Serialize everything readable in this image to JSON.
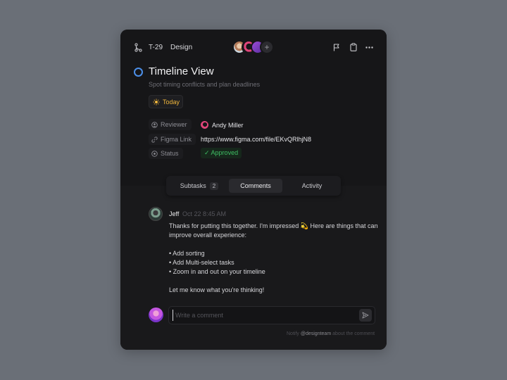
{
  "header": {
    "task_id": "T-29",
    "project": "Design",
    "avatar_more": "+",
    "icons": [
      "branch-icon",
      "flag-icon",
      "clipboard-icon",
      "more-icon"
    ]
  },
  "task": {
    "title": "Timeline View",
    "subtitle": "Spot timing conflicts and plan deadlines",
    "due_chip": "Today"
  },
  "properties": [
    {
      "label": "Reviewer",
      "icon": "user-circle-icon",
      "value": "Andy Miller"
    },
    {
      "label": "Figma Link",
      "icon": "link-icon",
      "value": "https://www.figma.com/file/EKvQRlhjN8"
    },
    {
      "label": "Status",
      "icon": "status-circle-icon",
      "value": "Approved"
    }
  ],
  "tabs": [
    {
      "label": "Subtasks",
      "count": "2"
    },
    {
      "label": "Comments"
    },
    {
      "label": "Activity"
    }
  ],
  "active_tab": "Comments",
  "comment": {
    "author": "Jeff",
    "time": "Oct 22 8:45 AM",
    "lines": [
      "Thanks for putting this together. I'm impressed 💫 Here are things that can",
      "improve overall experience:",
      "• Add sorting",
      "• Add Multi-select tasks",
      "• Zoom in and out on your timeline",
      "Let me know what you're thinking!"
    ]
  },
  "composer": {
    "placeholder": "Write a comment",
    "notify_prefix": "Notify",
    "notify_mention": "@designteam",
    "notify_suffix": "about the comment"
  },
  "colors": {
    "accent_blue": "#4c8fe8",
    "today_yellow": "#f1b73c",
    "approved_green": "#3fbf64"
  }
}
